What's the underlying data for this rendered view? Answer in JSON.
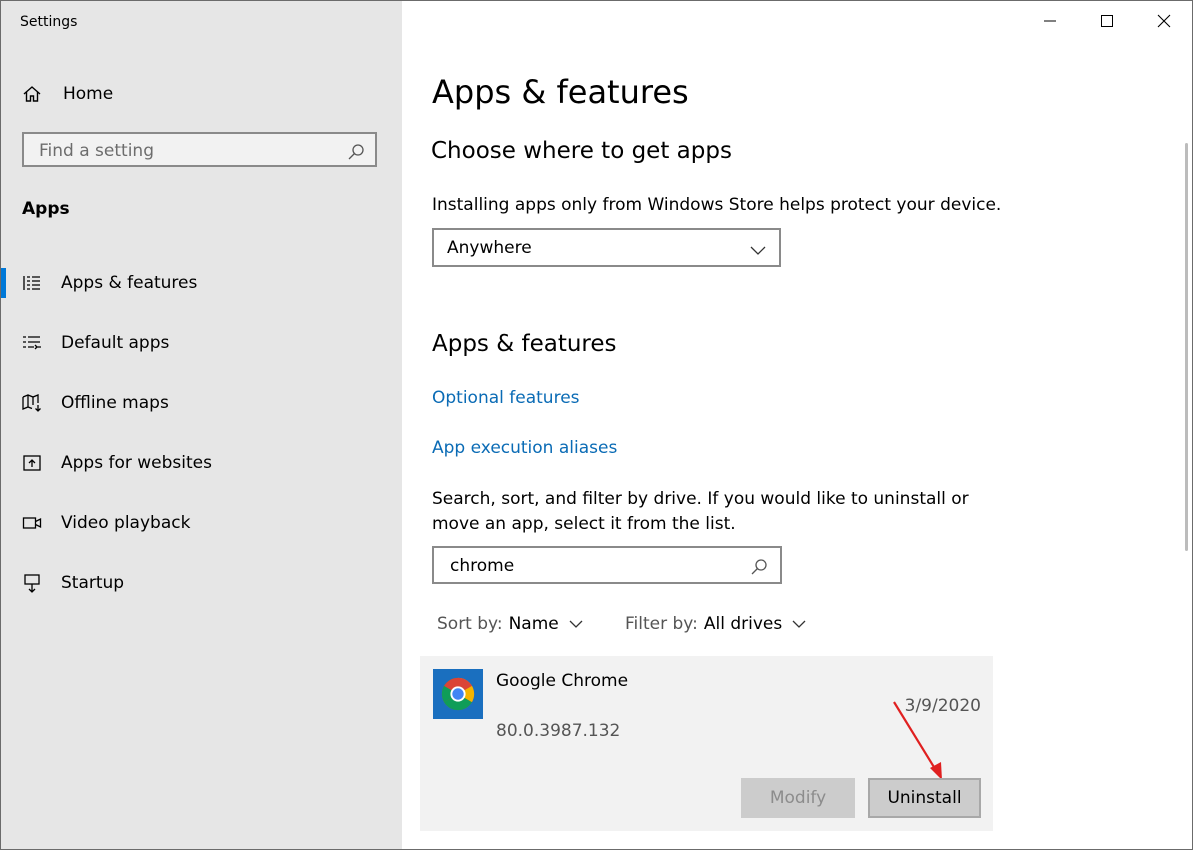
{
  "window": {
    "title": "Settings"
  },
  "sidebar": {
    "home_label": "Home",
    "search_placeholder": "Find a setting",
    "section_label": "Apps",
    "items": [
      {
        "label": "Apps & features",
        "icon": "list-icon",
        "active": true
      },
      {
        "label": "Default apps",
        "icon": "default-apps-icon",
        "active": false
      },
      {
        "label": "Offline maps",
        "icon": "map-download-icon",
        "active": false
      },
      {
        "label": "Apps for websites",
        "icon": "open-in-app-icon",
        "active": false
      },
      {
        "label": "Video playback",
        "icon": "video-icon",
        "active": false
      },
      {
        "label": "Startup",
        "icon": "startup-icon",
        "active": false
      }
    ]
  },
  "main": {
    "page_title": "Apps & features",
    "choose_title": "Choose where to get apps",
    "choose_desc": "Installing apps only from Windows Store helps protect your device.",
    "source_select_value": "Anywhere",
    "features_title": "Apps & features",
    "optional_features_link": "Optional features",
    "aliases_link": "App execution aliases",
    "search_desc": "Search, sort, and filter by drive. If you would like to uninstall or move an app, select it from the list.",
    "app_search_value": "chrome",
    "sort_label": "Sort by:",
    "sort_value": "Name",
    "filter_label": "Filter by:",
    "filter_value": "All drives",
    "app": {
      "name": "Google Chrome",
      "version": "80.0.3987.132",
      "date": "3/9/2020",
      "modify_label": "Modify",
      "uninstall_label": "Uninstall"
    }
  },
  "colors": {
    "accent": "#0078d7",
    "link": "#0a6bb5",
    "sidebar_bg": "#e6e6e6",
    "annotation_arrow": "#e02020"
  }
}
